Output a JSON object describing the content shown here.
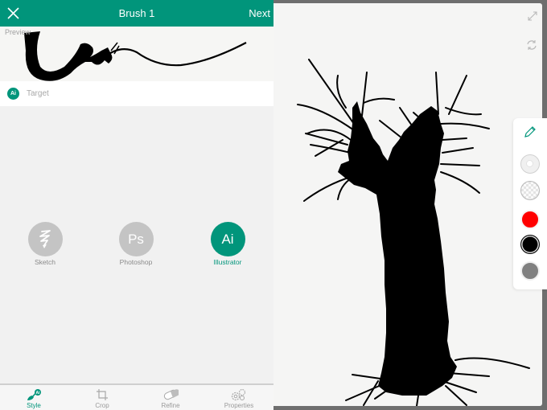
{
  "header": {
    "title": "Brush 1",
    "next_label": "Next",
    "close_icon": "close-icon"
  },
  "preview": {
    "label": "Preview"
  },
  "target": {
    "badge": "Ai",
    "label": "Target"
  },
  "apps": [
    {
      "name": "sketch",
      "label": "Sketch",
      "glyph": "",
      "active": false
    },
    {
      "name": "photoshop",
      "label": "Photoshop",
      "glyph": "Ps",
      "active": false
    },
    {
      "name": "illustrator",
      "label": "Illustrator",
      "glyph": "Ai",
      "active": true
    }
  ],
  "tabs": [
    {
      "name": "style",
      "label": "Style",
      "icon": "style-brush-icon",
      "active": true
    },
    {
      "name": "crop",
      "label": "Crop",
      "icon": "crop-icon",
      "active": false
    },
    {
      "name": "refine",
      "label": "Refine",
      "icon": "eraser-icon",
      "active": false
    },
    {
      "name": "properties",
      "label": "Properties",
      "icon": "gears-icon",
      "active": false
    }
  ],
  "canvas_controls": {
    "expand_icon": "expand-icon",
    "rotate_icon": "rotate-icon"
  },
  "palette": {
    "tool_icon": "pencil-icon",
    "swatches": [
      {
        "name": "opacity-white",
        "color": "#e6e6e6"
      },
      {
        "name": "transparent",
        "color": "checker"
      },
      {
        "name": "red",
        "color": "#ff0000"
      },
      {
        "name": "black",
        "color": "#000000",
        "selected": true
      },
      {
        "name": "gray",
        "color": "#808080"
      }
    ]
  },
  "colors": {
    "accent": "#01957b",
    "inactive": "#c4c4c4"
  }
}
